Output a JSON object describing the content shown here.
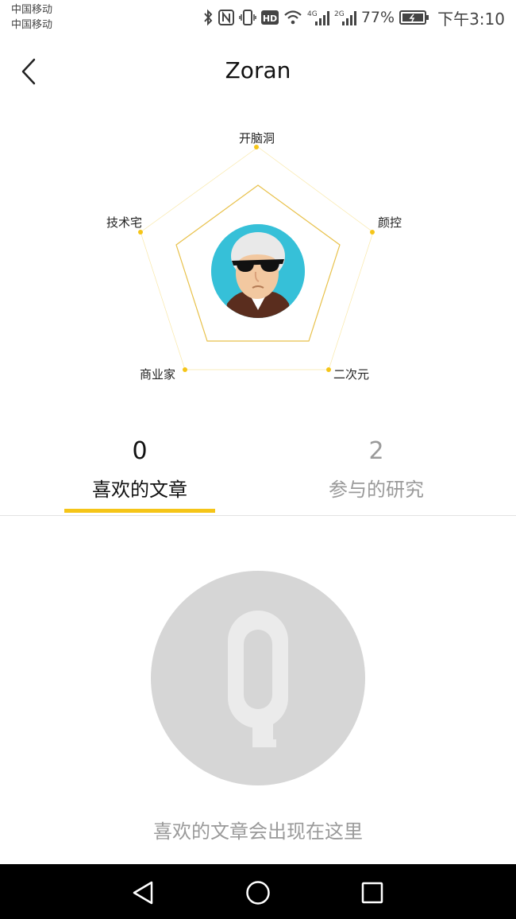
{
  "status_bar": {
    "carrier_1": "中国移动",
    "carrier_2": "中国移动",
    "battery": "77%",
    "time": "下午3:10",
    "icons": [
      "bluetooth-icon",
      "nfc-icon",
      "vibrate-icon",
      "hd-icon",
      "wifi-icon",
      "signal-4g-icon",
      "signal-2g-icon",
      "battery-icon"
    ]
  },
  "header": {
    "title": "Zoran",
    "back_icon": "back-chevron-icon"
  },
  "radar": {
    "labels": [
      "开脑洞",
      "颜控",
      "二次元",
      "商业家",
      "技术宅"
    ],
    "accent_color": "#f5c518",
    "avatar": "user-avatar"
  },
  "tabs": [
    {
      "count": "0",
      "label": "喜欢的文章",
      "active": true
    },
    {
      "count": "2",
      "label": "参与的研究",
      "active": false
    }
  ],
  "empty_state": {
    "icon": "q-logo-icon",
    "text": "喜欢的文章会出现在这里"
  },
  "nav_bar": {
    "icons": [
      "nav-back-icon",
      "nav-home-icon",
      "nav-recents-icon"
    ]
  }
}
